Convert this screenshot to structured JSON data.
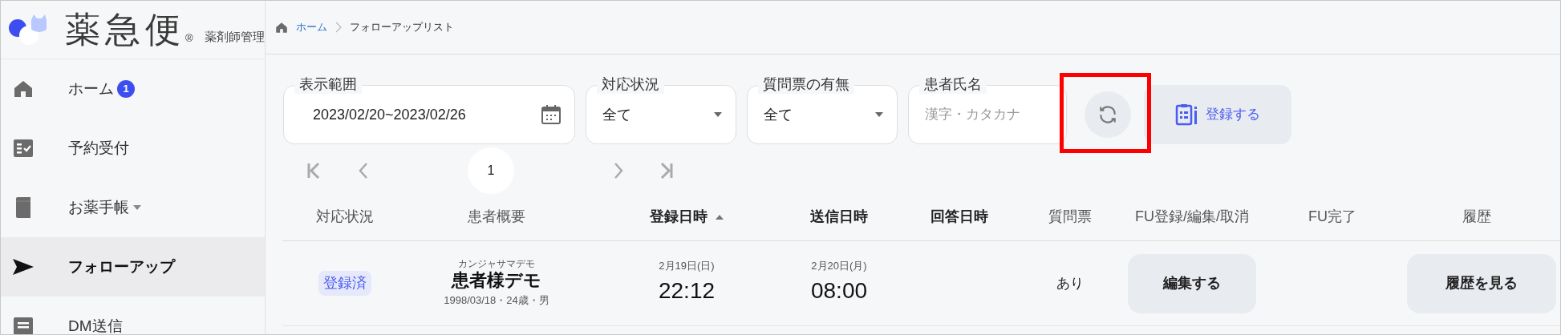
{
  "logo": {
    "name": "薬急便",
    "mark": "®",
    "subtitle": "薬剤師管理"
  },
  "sidebar": {
    "items": [
      {
        "kind": "home",
        "label": "ホーム",
        "badge": "1",
        "expandable": false,
        "selected": false
      },
      {
        "kind": "reservation",
        "label": "予約受付",
        "expandable": false,
        "selected": false
      },
      {
        "kind": "notebook",
        "label": "お薬手帳",
        "expandable": true,
        "selected": false
      },
      {
        "kind": "followup",
        "label": "フォローアップ",
        "expandable": false,
        "selected": true
      },
      {
        "kind": "dm",
        "label": "DM送信",
        "expandable": false,
        "selected": false
      }
    ]
  },
  "breadcrumb": [
    {
      "label": "ホーム",
      "link": true
    },
    {
      "label": "フォローアップリスト",
      "link": false
    }
  ],
  "filters": [
    {
      "kind": "date",
      "label": "表示範囲",
      "value": "2023/02/20~2023/02/26"
    },
    {
      "kind": "select",
      "label": "対応状況",
      "value": "全て"
    },
    {
      "kind": "select",
      "label": "質問票の有無",
      "value": "全て"
    },
    {
      "kind": "text",
      "label": "患者氏名",
      "placeholder": "漢字・カタカナ"
    }
  ],
  "register_button": "登録する",
  "pagination": {
    "pages": [
      {
        "label": "1",
        "selected": true
      }
    ]
  },
  "table": {
    "columns": [
      {
        "label": "対応状況",
        "bold": false
      },
      {
        "label": "患者概要",
        "bold": false
      },
      {
        "label": "登録日時",
        "bold": true,
        "sorted_ascending": true
      },
      {
        "label": "送信日時",
        "bold": true
      },
      {
        "label": "回答日時",
        "bold": true
      },
      {
        "label": "質問票",
        "bold": false
      },
      {
        "label": "FU登録/編集/取消",
        "bold": false
      },
      {
        "label": "FU完了",
        "bold": false
      },
      {
        "label": "履歴",
        "bold": false
      }
    ],
    "rows": [
      {
        "status": "登録済",
        "kana": "カンジャサマデモ",
        "name": "患者様デモ",
        "info": "1998/03/18・24歳・男",
        "registered": {
          "date": "2月19日(日)",
          "time": "22:12"
        },
        "sent": {
          "date": "2月20日(月)",
          "time": "08:00"
        },
        "questionnaire": "あり",
        "edit_button": "編集する",
        "history_button": "履歴を見る"
      }
    ]
  }
}
